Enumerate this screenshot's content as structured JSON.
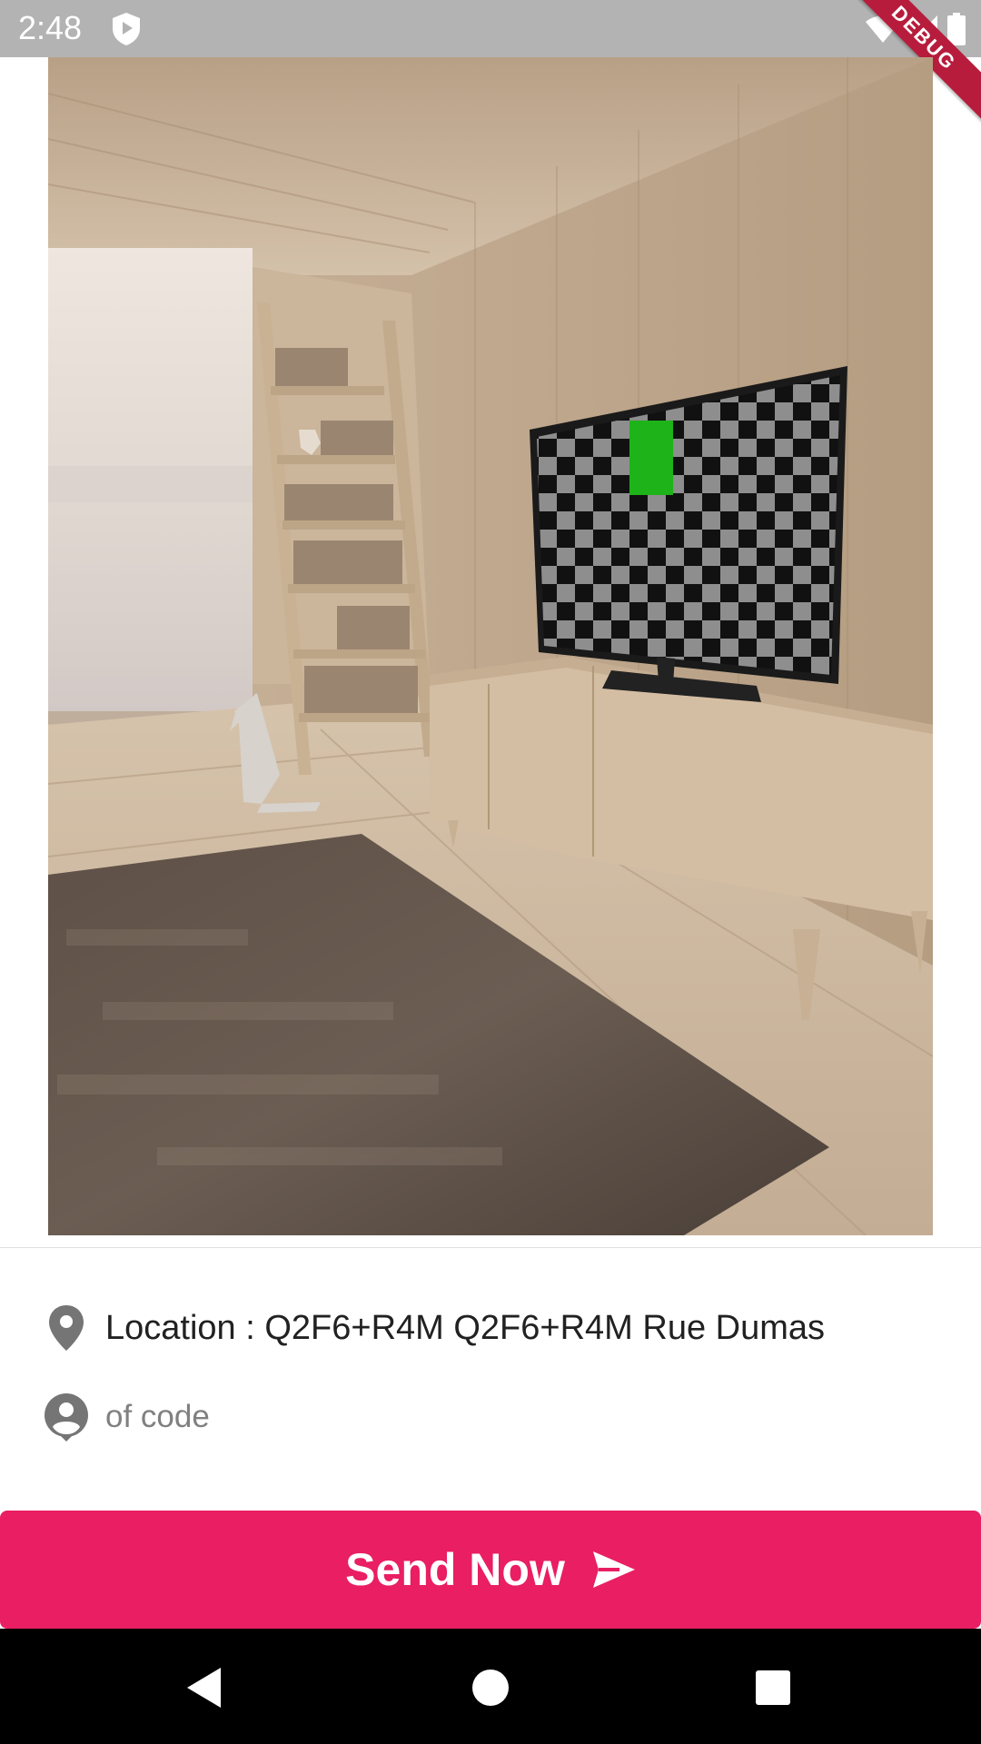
{
  "status_bar": {
    "time": "2:48",
    "debug_banner": "DEBUG",
    "icons": [
      "shield-icon",
      "wifi-icon",
      "signal-icon",
      "battery-icon"
    ]
  },
  "photo": {
    "icon": "room-photo"
  },
  "details": {
    "location_text": "Location : Q2F6+R4M Q2F6+R4M Rue Dumas",
    "location_icon": "location-pin-icon",
    "user_text": "of code",
    "user_icon": "account-circle-icon"
  },
  "send_button": {
    "label": "Send Now",
    "icon": "send-icon",
    "color": "#e91e63"
  },
  "nav_bar": {
    "buttons": [
      "back-icon",
      "home-icon",
      "recents-icon"
    ]
  },
  "colors": {
    "status_bar": "#b3b3b3",
    "accent": "#e91e63",
    "debug_ribbon": "#b71c3c"
  }
}
